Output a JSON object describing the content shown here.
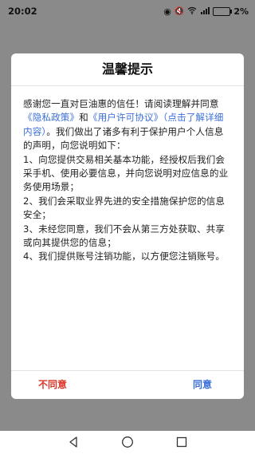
{
  "status_bar": {
    "time": "20:02",
    "battery": "2%",
    "icons": [
      "eye-icon",
      "mute-icon",
      "wifi-icon",
      "signal-4g-icon",
      "battery-icon"
    ]
  },
  "dialog": {
    "title": "温馨提示",
    "body": {
      "intro_text": "感谢您一直对巨油惠的信任！请阅读理解并同意",
      "privacy_link": "《隐私政策》",
      "and_text": "和",
      "license_link": "《用户许可协议》",
      "detail_link": "（点击了解详细内容）",
      "intro_rest": "。我们做出了诸多有利于保护用户个人信息的声明，向您说明如下：",
      "items": [
        "1、向您提供交易相关基本功能，经授权后我们会采手机、使用必要信息，并向您说明对应信息的业务使用场景；",
        "2、我们会采取业界先进的安全措施保护您的信息安全；",
        "3、未经您同意，我们不会从第三方处获取、共享或向其提供您的信息；",
        "4、我们提供账号注销功能，以方便您注销账号。"
      ]
    },
    "buttons": {
      "disagree": "不同意",
      "agree": "同意"
    }
  },
  "colors": {
    "link": "#3b6fd8",
    "disagree": "#d9382c",
    "overlay": "#8a8a8a"
  },
  "nav_bar": {
    "icons": [
      "back-icon",
      "home-icon",
      "recent-apps-icon"
    ]
  }
}
